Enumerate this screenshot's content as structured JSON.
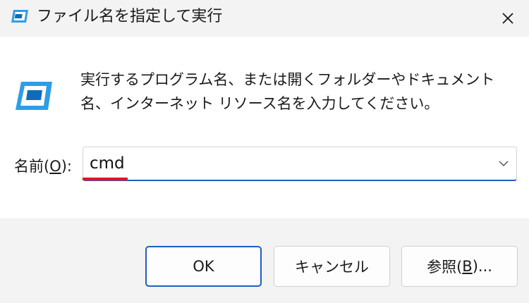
{
  "titlebar": {
    "title": "ファイル名を指定して実行",
    "icon": "run-dialog-icon",
    "close_icon": "close-icon"
  },
  "content": {
    "icon": "run-dialog-icon",
    "description": "実行するプログラム名、または開くフォルダーやドキュメント名、インターネット リソース名を入力してください。"
  },
  "name_field": {
    "label_prefix": "名前(",
    "label_access_key": "O",
    "label_suffix": "):",
    "value": "cmd",
    "dropdown_icon": "chevron-down-icon"
  },
  "buttons": {
    "ok": "OK",
    "cancel": "キャンセル",
    "browse_prefix": "参照(",
    "browse_access_key": "B",
    "browse_suffix": ")..."
  },
  "colors": {
    "accent": "#1f5fbf",
    "annotation_underline": "#e5141f",
    "icon_blue": "#2e9de6"
  }
}
